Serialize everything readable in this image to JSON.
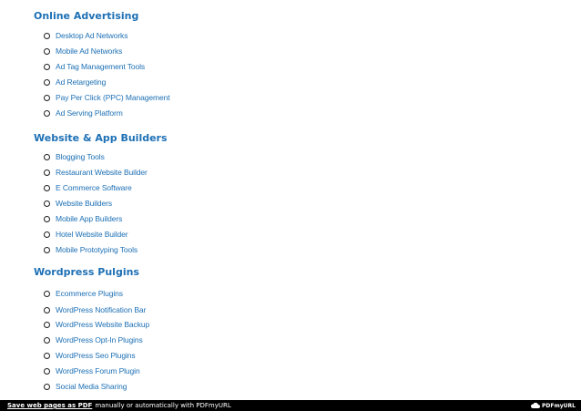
{
  "sections": [
    {
      "title": "Online Advertising",
      "items": [
        "Desktop Ad Networks",
        "Mobile Ad Networks",
        "Ad Tag Management Tools",
        "Ad Retargeting",
        "Pay Per Click (PPC) Management",
        "Ad Serving Platform"
      ]
    },
    {
      "title": "Website & App Builders",
      "items": [
        "Blogging Tools",
        "Restaurant Website Builder",
        "E Commerce Software",
        "Website Builders",
        "Mobile App Builders",
        "Hotel Website Builder",
        "Mobile Prototyping Tools"
      ]
    },
    {
      "title": "Wordpress Pulgins",
      "items": [
        "Ecommerce Plugins",
        "WordPress Notification Bar",
        "WordPress Website Backup",
        "WordPress Opt-In Plugins",
        "WordPress Seo Plugins",
        "WordPress Forum Plugin",
        "Social Media Sharing"
      ]
    }
  ],
  "footer": {
    "link_label": "Save web pages as PDF",
    "text": "manually or automatically with PDFmyURL",
    "logo_text": "PDFmyURL"
  },
  "colors": {
    "link": "#1d70b5",
    "footer_bg": "#000000",
    "footer_text": "#ffffff"
  }
}
